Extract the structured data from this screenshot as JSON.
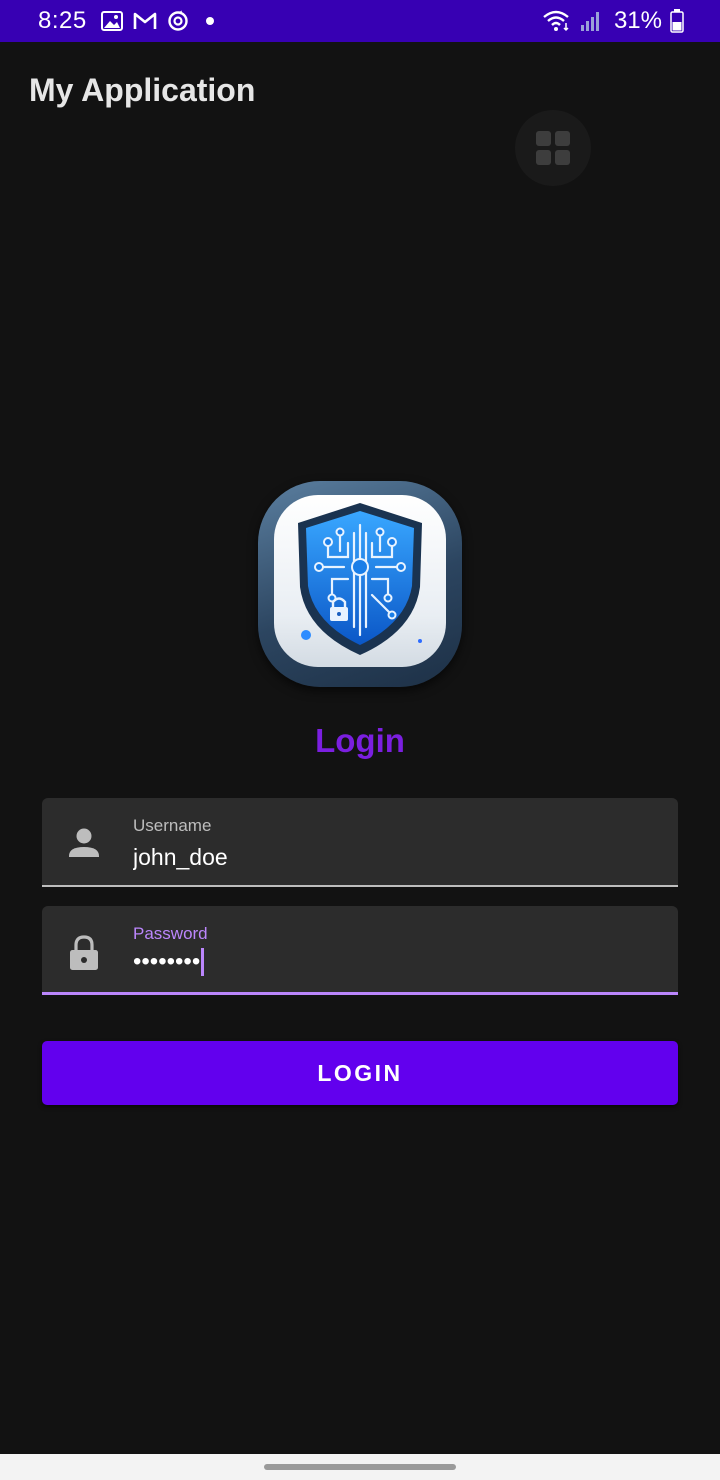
{
  "status_bar": {
    "time": "8:25",
    "battery_percent": "31%",
    "left_icons": [
      "image-icon",
      "gmail-icon",
      "sync-icon",
      "dot-icon"
    ],
    "right_icons": [
      "wifi-icon",
      "signal-icon",
      "battery-icon"
    ],
    "background_color": "#3700b3"
  },
  "app_bar": {
    "title": "My Application",
    "grid_button_icon": "grid-icon"
  },
  "login": {
    "logo_icon": "shield-circuit-lock-icon",
    "heading": "Login",
    "heading_color": "#7b1fe0",
    "username": {
      "label": "Username",
      "value": "john_doe",
      "icon": "person-icon"
    },
    "password": {
      "label": "Password",
      "masked_value": "••••••••",
      "icon": "lock-icon",
      "focused": true
    },
    "button_label": "LOGIN",
    "button_color": "#6200ee",
    "accent_color": "#bb86fc"
  }
}
